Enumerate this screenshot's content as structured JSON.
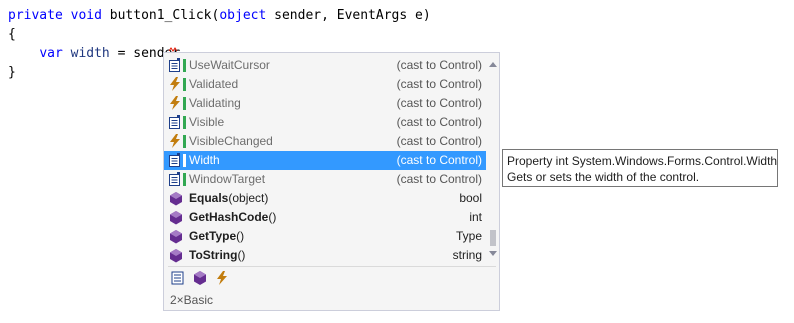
{
  "code": {
    "line1": {
      "kw1": "private",
      "kw2": "void",
      "rest": " button1_Click(",
      "kw3": "object",
      "params": " sender, EventArgs e)"
    },
    "line2": "{",
    "line3": {
      "kw": "var",
      "var": "width",
      "rest": " = sender."
    },
    "line4": "}"
  },
  "completion": {
    "items": [
      {
        "icon": "property-icon",
        "name": "UseWaitCursor",
        "type": "(cast to Control)"
      },
      {
        "icon": "event-icon",
        "name": "Validated",
        "type": "(cast to Control)"
      },
      {
        "icon": "event-icon",
        "name": "Validating",
        "type": "(cast to Control)"
      },
      {
        "icon": "property-icon",
        "name": "Visible",
        "type": "(cast to Control)"
      },
      {
        "icon": "event-icon",
        "name": "VisibleChanged",
        "type": "(cast to Control)"
      },
      {
        "icon": "property-icon",
        "name": "Width",
        "type": "(cast to Control)",
        "selected": true
      },
      {
        "icon": "property-icon",
        "name": "WindowTarget",
        "type": "(cast to Control)"
      },
      {
        "icon": "method-icon",
        "name_bold": "Equals",
        "name_rest": "(object)",
        "type": "bool"
      },
      {
        "icon": "method-icon",
        "name_bold": "GetHashCode",
        "name_rest": "()",
        "type": "int"
      },
      {
        "icon": "method-icon",
        "name_bold": "GetType",
        "name_rest": "()",
        "type": "Type"
      },
      {
        "icon": "method-icon",
        "name_bold": "ToString",
        "name_rest": "()",
        "type": "string"
      }
    ],
    "filters": [
      "property-filter-icon",
      "method-filter-icon",
      "event-filter-icon"
    ],
    "status": "2×Basic"
  },
  "tooltip": {
    "line1": "Property int System.Windows.Forms.Control.Width",
    "line2": "Gets or sets the width of the control."
  },
  "colors": {
    "keyword": "#0000ff",
    "selection": "#3399ff",
    "cast_bar": "#32a852",
    "method": "#652d90",
    "event": "#c27d0e"
  }
}
